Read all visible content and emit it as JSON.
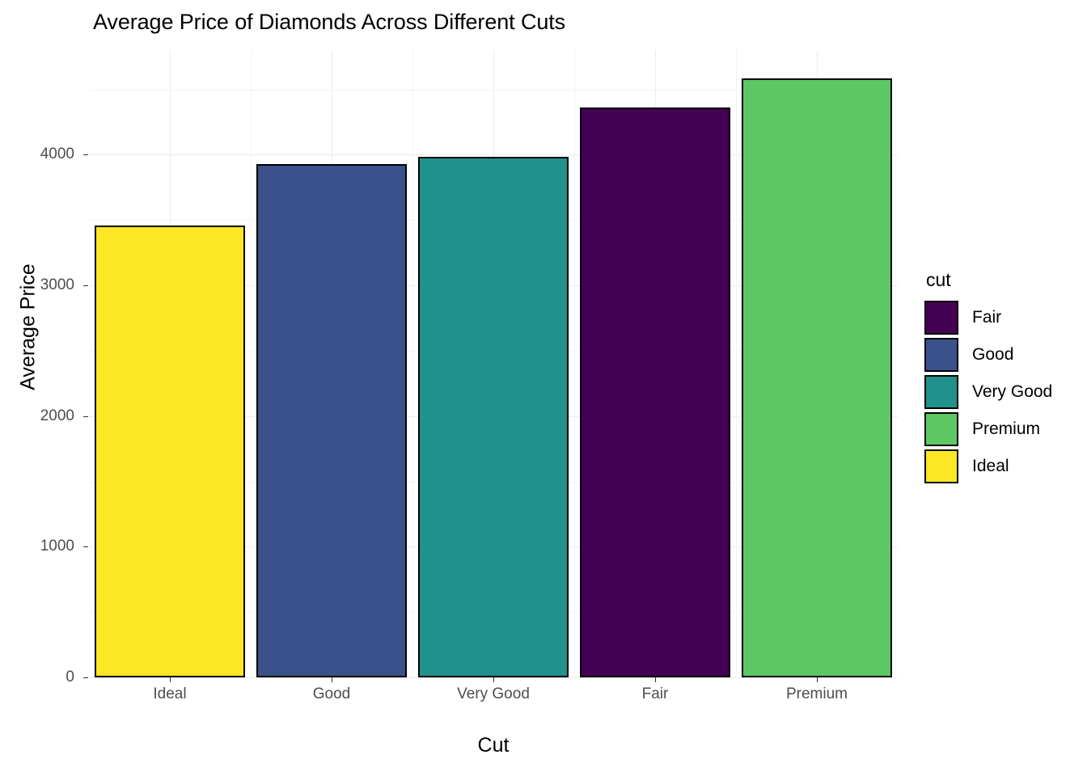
{
  "chart_data": {
    "type": "bar",
    "title": "Average Price of Diamonds Across Different Cuts",
    "xlabel": "Cut",
    "ylabel": "Average Price",
    "categories": [
      "Ideal",
      "Good",
      "Very Good",
      "Fair",
      "Premium"
    ],
    "values": [
      3458,
      3929,
      3982,
      4359,
      4584
    ],
    "series": [
      {
        "name": "Average Price",
        "values": [
          3458,
          3929,
          3982,
          4359,
          4584
        ]
      }
    ],
    "bar_colors": [
      "#FDE725",
      "#3B518B",
      "#21918C",
      "#440154",
      "#5DC863"
    ],
    "ylim": [
      0,
      4800
    ],
    "y_ticks": [
      0,
      1000,
      2000,
      3000,
      4000
    ],
    "y_tick_labels": [
      "0",
      "1000",
      "2000",
      "3000",
      "4000"
    ],
    "y_minor_ticks": [
      500,
      1500,
      2500,
      3500,
      4500
    ],
    "grid": true,
    "legend_position": "right",
    "legend": {
      "title": "cut",
      "entries": [
        {
          "label": "Fair",
          "color": "#440154"
        },
        {
          "label": "Good",
          "color": "#3B518B"
        },
        {
          "label": "Very Good",
          "color": "#21918C"
        },
        {
          "label": "Premium",
          "color": "#5DC863"
        },
        {
          "label": "Ideal",
          "color": "#FDE725"
        }
      ]
    },
    "theme": {
      "panel_background": "#FFFFFF",
      "grid_major_color": "#EBEBEB",
      "grid_minor_color": "#F4F4F4",
      "bar_outline_color": "#000000",
      "axis_text_color": "#4D4D4D",
      "axis_title_color": "#000000"
    }
  }
}
